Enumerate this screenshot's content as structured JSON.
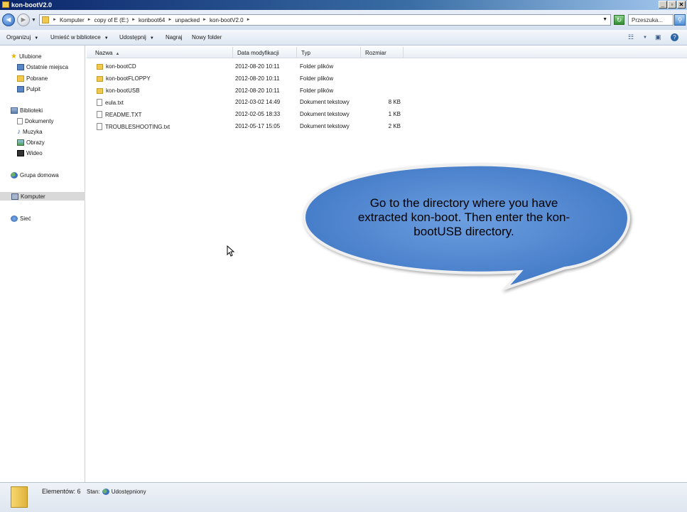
{
  "window": {
    "title": "kon-bootV2.0"
  },
  "address": {
    "crumbs": [
      "Komputer",
      "copy of E (E:)",
      "konboot64",
      "unpacked",
      "kon-bootV2.0"
    ],
    "search_placeholder": "Przeszuka..."
  },
  "toolbar": {
    "organize": "Organizuj",
    "include_library": "Umieść w bibliotece",
    "share": "Udostępnij",
    "burn": "Nagraj",
    "new_folder": "Nowy folder"
  },
  "nav": {
    "favorites": "Ulubione",
    "recent": "Ostatnie miejsca",
    "downloads": "Pobrane",
    "desktop": "Pulpit",
    "libraries": "Biblioteki",
    "documents": "Dokumenty",
    "music": "Muzyka",
    "pictures": "Obrazy",
    "videos": "Wideo",
    "homegroup": "Grupa domowa",
    "computer": "Komputer",
    "network": "Sieć"
  },
  "columns": {
    "name": "Nazwa",
    "date": "Data modyfikacji",
    "type": "Typ",
    "size": "Rozmiar"
  },
  "files": [
    {
      "name": "kon-bootCD",
      "date": "2012-08-20 10:11",
      "type": "Folder plików",
      "size": "",
      "kind": "folder"
    },
    {
      "name": "kon-bootFLOPPY",
      "date": "2012-08-20 10:11",
      "type": "Folder plików",
      "size": "",
      "kind": "folder"
    },
    {
      "name": "kon-bootUSB",
      "date": "2012-08-20 10:11",
      "type": "Folder plików",
      "size": "",
      "kind": "folder"
    },
    {
      "name": "eula.txt",
      "date": "2012-03-02 14:49",
      "type": "Dokument tekstowy",
      "size": "8 KB",
      "kind": "txt"
    },
    {
      "name": "README.TXT",
      "date": "2012-02-05 18:33",
      "type": "Dokument tekstowy",
      "size": "1 KB",
      "kind": "txt"
    },
    {
      "name": "TROUBLESHOOTING.txt",
      "date": "2012-05-17 15:05",
      "type": "Dokument tekstowy",
      "size": "2 KB",
      "kind": "txt"
    }
  ],
  "callout": {
    "line1": "Go to the directory where you have",
    "line2": "extracted kon-boot. Then enter the kon-",
    "line3": "bootUSB directory."
  },
  "status": {
    "items": "Elementów: 6",
    "state_label": "Stan:",
    "state_value": "Udostępniony"
  },
  "colors": {
    "bubble_fill": "#4f86cf",
    "bubble_stroke": "#f2f2f2",
    "title_bar": "#0a246a"
  }
}
